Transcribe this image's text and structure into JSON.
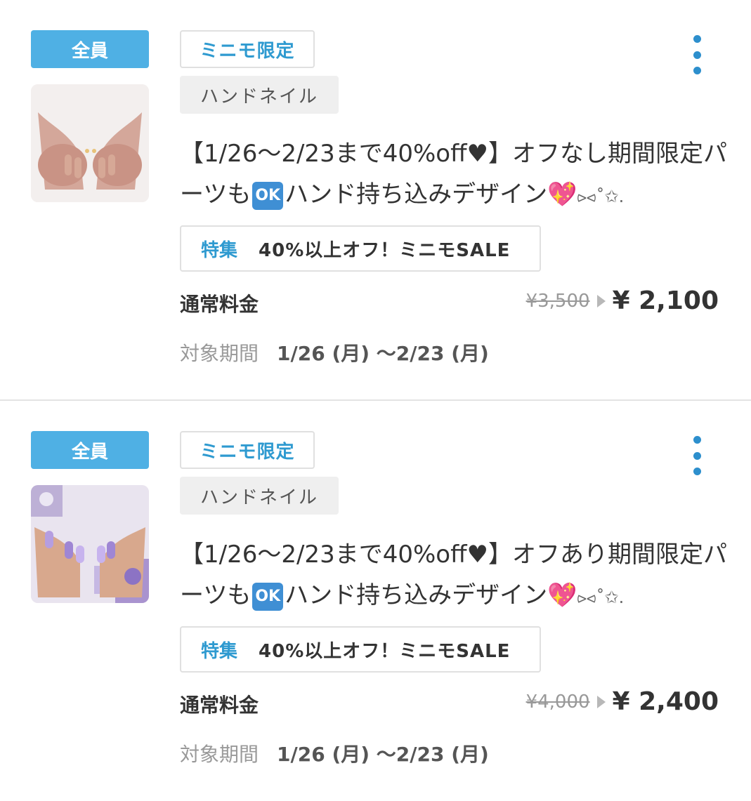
{
  "coupons": [
    {
      "badge": "全員",
      "limited_tag": "ミニモ限定",
      "category": "ハンドネイル",
      "title_part1": "【1/26～2/23まで40%off",
      "title_heart": "♥",
      "title_part2": "】オフなし期間限定パーツも",
      "ok_emoji": "OK",
      "title_part3": "ハンド持ち込みデザイン",
      "sparkle_heart_emoji": "💖",
      "title_tail": "⪧⪦˚✩.",
      "feature_label": "特集",
      "feature_text": "40%以上オフ！ミニモSALE",
      "price_label": "通常料金",
      "old_price": "¥3,500",
      "new_price": "¥ 2,100",
      "period_label": "対象期間",
      "period_value": "1/26 (月) ～2/23 (月)",
      "menu_icon": "more-vertical-icon"
    },
    {
      "badge": "全員",
      "limited_tag": "ミニモ限定",
      "category": "ハンドネイル",
      "title_part1": "【1/26～2/23まで40%off",
      "title_heart": "♥",
      "title_part2": "】オフあり期間限定パーツも",
      "ok_emoji": "OK",
      "title_part3": "ハンド持ち込みデザイン",
      "sparkle_heart_emoji": "💖",
      "title_tail": "⪧⪦˚✩.",
      "feature_label": "特集",
      "feature_text": "40%以上オフ！ミニモSALE",
      "price_label": "通常料金",
      "old_price": "¥4,000",
      "new_price": "¥ 2,400",
      "period_label": "対象期間",
      "period_value": "1/26 (月) ～2/23 (月)",
      "menu_icon": "more-vertical-icon"
    }
  ],
  "colors": {
    "accent": "#2e9ad0",
    "badge_bg": "#4fb0e4",
    "menu_dots": "#2d8fcd"
  }
}
